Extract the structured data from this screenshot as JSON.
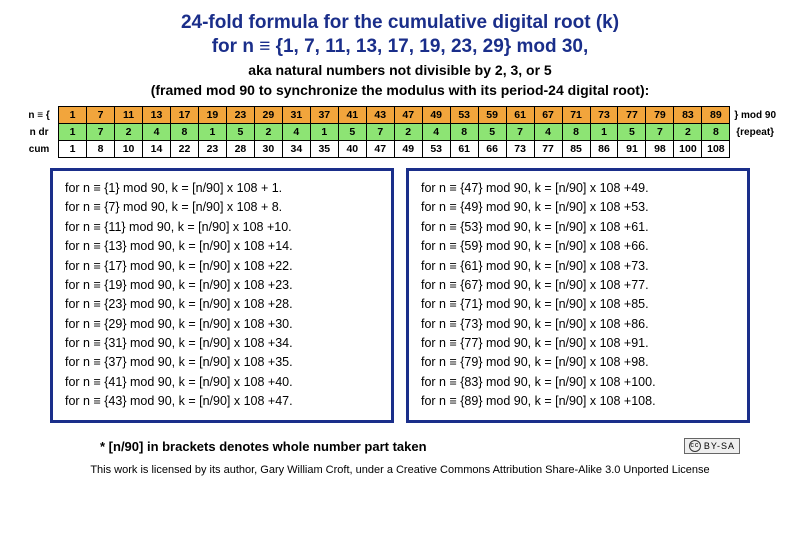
{
  "title_line1": "24-fold formula for the cumulative digital root (k)",
  "title_line2": "for n ≡ {1, 7, 11, 13, 17, 19, 23, 29} mod 30,",
  "subtitle1": "aka natural numbers not divisible by 2, 3, or 5",
  "subtitle2": "(framed mod 90 to synchronize the modulus with its period-24 digital root):",
  "rowlabels": {
    "r1": "n ≡ {",
    "r2": "n dr",
    "r3": "cum"
  },
  "rowends": {
    "r1": "} mod 90",
    "r2": "{repeat}",
    "r3": ""
  },
  "chart_data": {
    "type": "table",
    "columns": [
      "1",
      "7",
      "11",
      "13",
      "17",
      "19",
      "23",
      "29",
      "31",
      "37",
      "41",
      "43",
      "47",
      "49",
      "53",
      "59",
      "61",
      "67",
      "71",
      "73",
      "77",
      "79",
      "83",
      "89"
    ],
    "rows": [
      {
        "name": "n",
        "values": [
          "1",
          "7",
          "11",
          "13",
          "17",
          "19",
          "23",
          "29",
          "31",
          "37",
          "41",
          "43",
          "47",
          "49",
          "53",
          "59",
          "61",
          "67",
          "71",
          "73",
          "77",
          "79",
          "83",
          "89"
        ]
      },
      {
        "name": "n dr",
        "values": [
          "1",
          "7",
          "2",
          "4",
          "8",
          "1",
          "5",
          "2",
          "4",
          "1",
          "5",
          "7",
          "2",
          "4",
          "8",
          "5",
          "7",
          "4",
          "8",
          "1",
          "5",
          "7",
          "2",
          "8"
        ]
      },
      {
        "name": "cum",
        "values": [
          "1",
          "8",
          "10",
          "14",
          "22",
          "23",
          "28",
          "30",
          "34",
          "35",
          "40",
          "47",
          "49",
          "53",
          "61",
          "66",
          "73",
          "77",
          "85",
          "86",
          "91",
          "98",
          "100",
          "108"
        ]
      }
    ]
  },
  "formulas_left": [
    "for n ≡ {1} mod 90, k = [n/90] x 108 + 1.",
    "for n ≡ {7} mod 90, k = [n/90] x 108 + 8.",
    "for n ≡ {11} mod 90, k = [n/90] x 108 +10.",
    "for n ≡ {13} mod 90, k = [n/90] x 108 +14.",
    "for n ≡ {17} mod 90, k = [n/90] x 108 +22.",
    "for n ≡ {19} mod 90, k = [n/90] x 108 +23.",
    "for n ≡ {23} mod 90, k = [n/90] x 108 +28.",
    "for n ≡ {29} mod 90, k = [n/90] x 108 +30.",
    "for n ≡ {31} mod 90, k = [n/90] x 108 +34.",
    "for n ≡ {37} mod 90, k = [n/90] x 108 +35.",
    "for n ≡ {41} mod 90, k = [n/90] x 108 +40.",
    "for n ≡ {43} mod 90, k = [n/90] x 108 +47."
  ],
  "formulas_right": [
    "for n ≡ {47} mod 90, k = [n/90] x 108 +49.",
    "for n ≡ {49} mod 90, k = [n/90] x 108 +53.",
    "for n ≡ {53} mod 90, k = [n/90] x 108 +61.",
    "for n ≡ {59} mod 90, k = [n/90] x 108 +66.",
    "for n ≡ {61} mod 90, k = [n/90] x 108 +73.",
    "for n ≡ {67} mod 90, k = [n/90] x 108 +77.",
    "for n ≡ {71} mod 90, k = [n/90] x 108 +85.",
    "for n ≡ {73} mod 90, k = [n/90] x 108 +86.",
    "for n ≡ {77} mod 90, k = [n/90] x 108 +91.",
    "for n ≡ {79} mod 90, k = [n/90] x 108 +98.",
    "for n ≡ {83} mod 90, k = [n/90] x 108 +100.",
    "for n ≡ {89} mod 90, k = [n/90] x 108 +108."
  ],
  "footnote": "* [n/90] in brackets denotes  whole number part taken",
  "cc_label": "BY-SA",
  "license": "This work is licensed by its author,  Gary William Croft, under a Creative Commons Attribution Share-Alike 3.0 Unported License"
}
